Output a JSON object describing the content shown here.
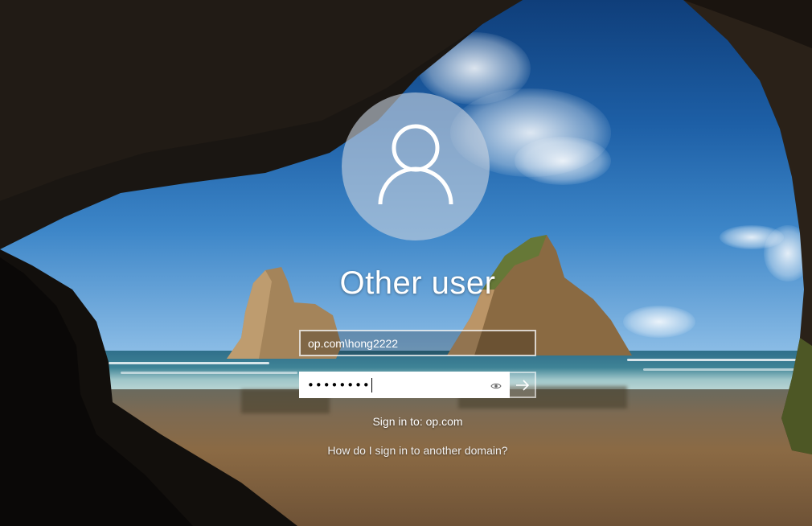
{
  "user": {
    "display_name": "Other user",
    "avatar_icon": "user-silhouette-icon"
  },
  "form": {
    "username_value": "op.com\\hong2222",
    "password_masked": "••••••••",
    "reveal_icon": "eye-icon",
    "submit_icon": "arrow-right-icon"
  },
  "footer": {
    "signin_to": "Sign in to: op.com",
    "other_domain_link": "How do I sign in to another domain?"
  }
}
